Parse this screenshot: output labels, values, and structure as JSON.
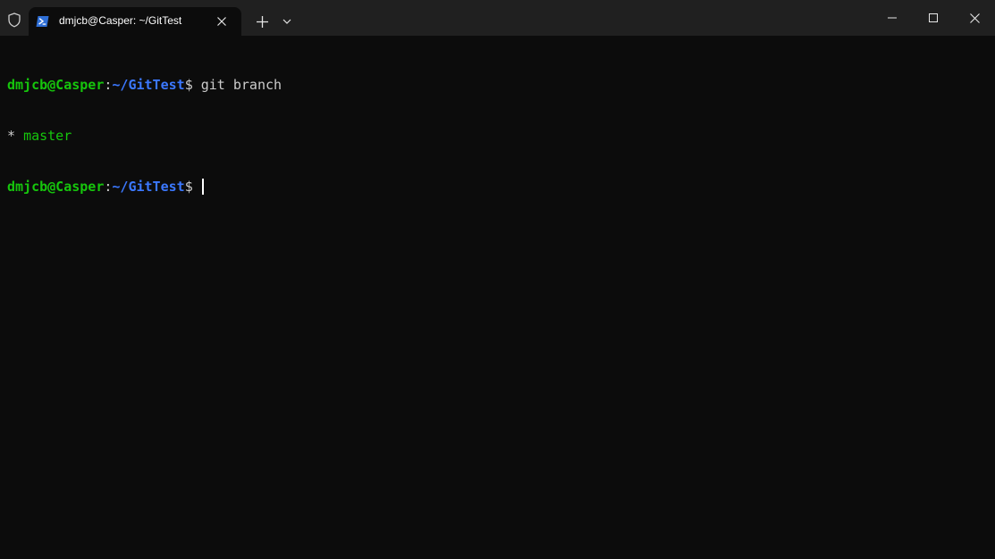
{
  "tab": {
    "title": "dmjcb@Casper: ~/GitTest",
    "icon": "powershell-icon"
  },
  "titlebar": {
    "shield_icon": "shield-icon",
    "new_tab_icon": "plus-icon",
    "dropdown_icon": "chevron-down-icon",
    "minimize_icon": "minimize-icon",
    "maximize_icon": "maximize-icon",
    "close_icon": "close-icon"
  },
  "terminal": {
    "prompt_user": "dmjcb@Casper",
    "prompt_colon": ":",
    "prompt_path": "~/GitTest",
    "prompt_dollar": "$",
    "command1": " git branch",
    "branch_marker": "* ",
    "branch_name": "master"
  },
  "colors": {
    "background": "#0c0c0c",
    "titlebar": "#202020",
    "prompt_user": "#16c60c",
    "prompt_path": "#3b78ff",
    "text": "#cccccc",
    "tab_icon": "#2f6fd6"
  }
}
